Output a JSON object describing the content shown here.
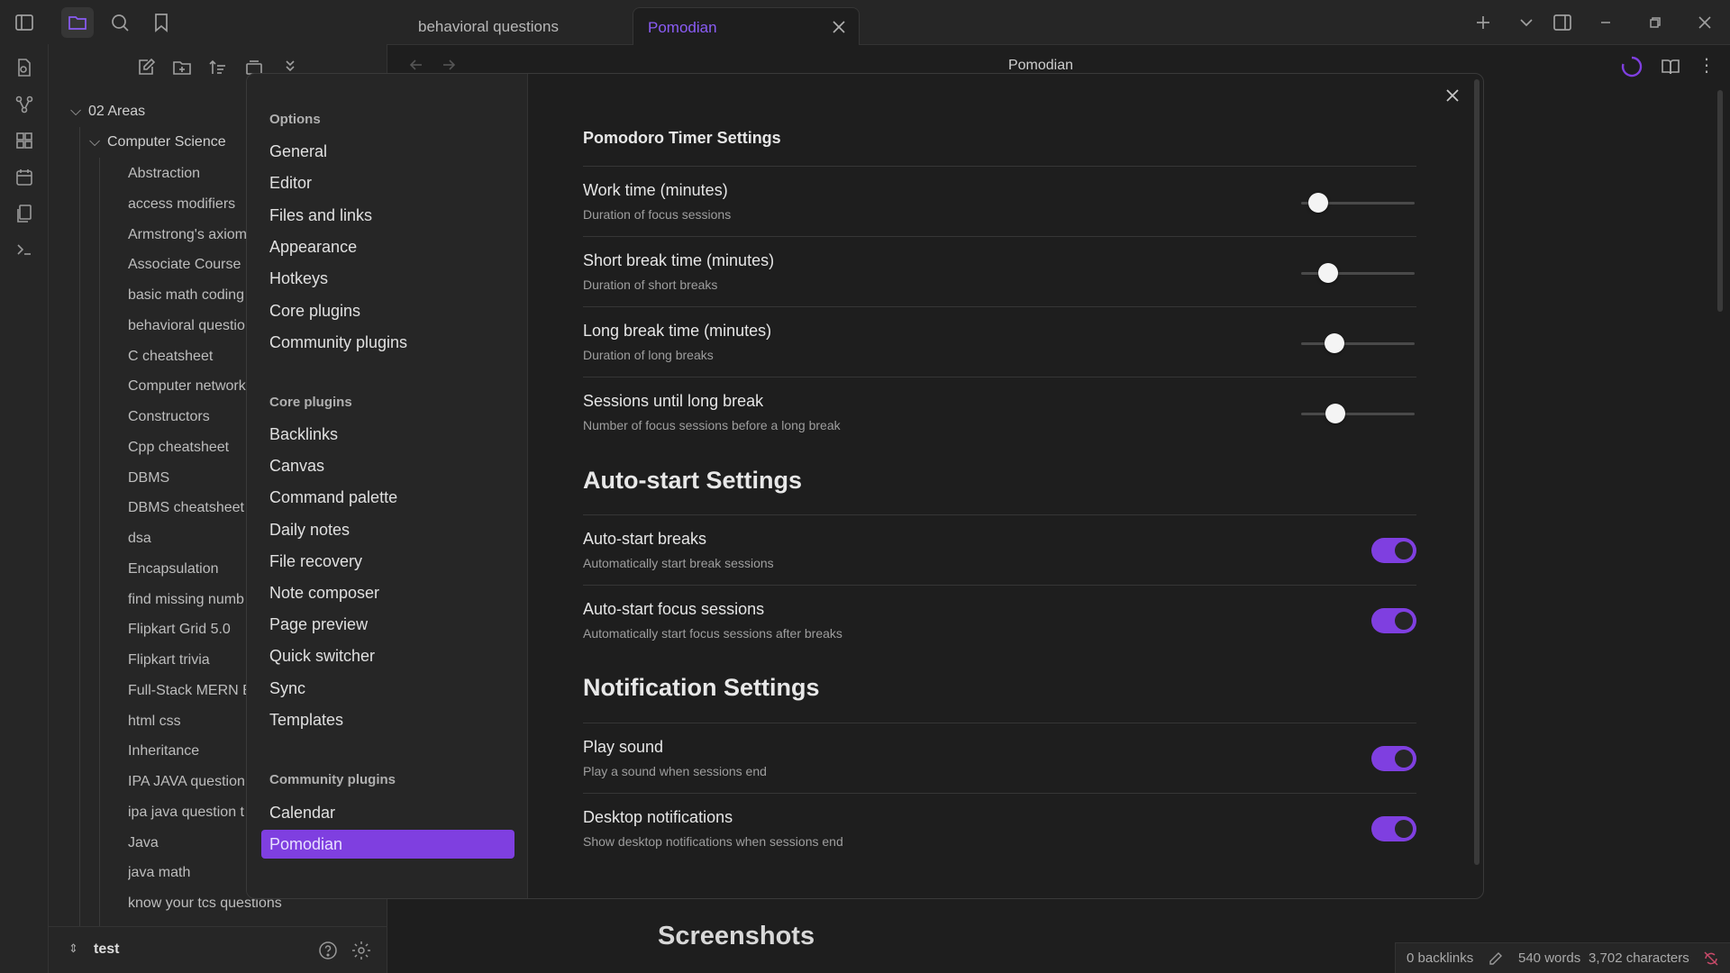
{
  "tabs": [
    {
      "label": "behavioral questions"
    },
    {
      "label": "Pomodian"
    }
  ],
  "main": {
    "title": "Pomodian",
    "heading_below": "Screenshots"
  },
  "file_tree": {
    "folder_areas": "02 Areas",
    "folder_cs": "Computer Science",
    "files": [
      "Abstraction",
      "access modifiers",
      "Armstrong's axiom",
      "Associate Course M",
      "basic math coding",
      "behavioral questio",
      "C cheatsheet",
      "Computer network",
      "Constructors",
      "Cpp cheatsheet",
      "DBMS",
      "DBMS cheatsheet",
      "dsa",
      "Encapsulation",
      "find missing numb",
      "Flipkart Grid 5.0",
      "Flipkart trivia",
      "Full-Stack MERN B",
      "html css",
      "Inheritance",
      "IPA JAVA question",
      "ipa java question t",
      "Java",
      "java math",
      "know your tcs questions"
    ]
  },
  "vault": {
    "name": "test"
  },
  "statusbar": {
    "backlinks": "0 backlinks",
    "words": "540 words",
    "characters": "3,702 characters"
  },
  "settings_nav": {
    "options_heading": "Options",
    "options": [
      "General",
      "Editor",
      "Files and links",
      "Appearance",
      "Hotkeys",
      "Core plugins",
      "Community plugins"
    ],
    "core_heading": "Core plugins",
    "core": [
      "Backlinks",
      "Canvas",
      "Command palette",
      "Daily notes",
      "File recovery",
      "Note composer",
      "Page preview",
      "Quick switcher",
      "Sync",
      "Templates"
    ],
    "community_heading": "Community plugins",
    "community": [
      "Calendar",
      "Pomodian"
    ]
  },
  "settings": {
    "timer_heading": "Pomodoro Timer Settings",
    "work_name": "Work time (minutes)",
    "work_desc": "Duration of focus sessions",
    "short_name": "Short break time (minutes)",
    "short_desc": "Duration of short breaks",
    "long_name": "Long break time (minutes)",
    "long_desc": "Duration of long breaks",
    "sessions_name": "Sessions until long break",
    "sessions_desc": "Number of focus sessions before a long break",
    "autostart_heading": "Auto-start Settings",
    "ab_name": "Auto-start breaks",
    "ab_desc": "Automatically start break sessions",
    "af_name": "Auto-start focus sessions",
    "af_desc": "Automatically start focus sessions after breaks",
    "notif_heading": "Notification Settings",
    "ps_name": "Play sound",
    "ps_desc": "Play a sound when sessions end",
    "dn_name": "Desktop notifications",
    "dn_desc": "Show desktop notifications when sessions end",
    "slider_levels": {
      "work": 0.08,
      "short": 0.18,
      "long": 0.25,
      "sessions": 0.26
    },
    "toggles_on": {
      "auto_breaks": true,
      "auto_focus": true,
      "play_sound": true,
      "desktop_notifications": true
    }
  },
  "colors": {
    "accent": "#7f3fe0",
    "tab_active_text": "#8a5cf5"
  }
}
